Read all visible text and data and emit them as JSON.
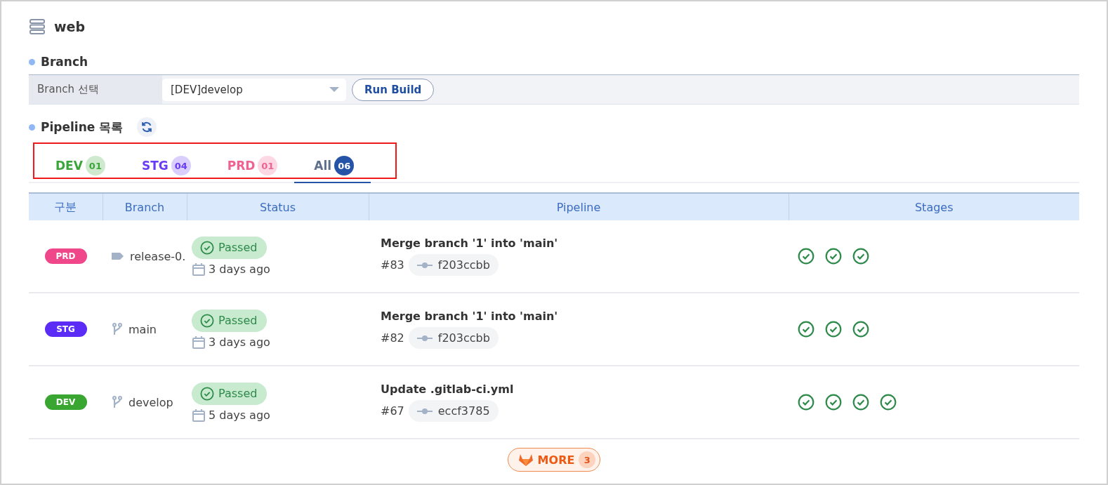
{
  "title": "web",
  "branch_section": {
    "heading": "Branch",
    "label": "Branch 선택",
    "select_value": "[DEV]develop",
    "run_button": "Run Build"
  },
  "pipeline_section": {
    "heading": "Pipeline 목록"
  },
  "tabs": [
    {
      "label": "DEV",
      "count": "01",
      "color": "#3aa63a",
      "selected": false
    },
    {
      "label": "STG",
      "count": "04",
      "color": "#6a3cf5",
      "selected": false
    },
    {
      "label": "PRD",
      "count": "01",
      "color": "#f06292",
      "selected": false
    },
    {
      "label": "All",
      "count": "06",
      "color": "#60708c",
      "selected": true
    }
  ],
  "table": {
    "columns": [
      "구분",
      "Branch",
      "Status",
      "Pipeline",
      "Stages"
    ],
    "rows": [
      {
        "env": "PRD",
        "color": "#f0468a",
        "kind": "tag",
        "branch": "release-0.",
        "status": "Passed",
        "time": "3 days ago",
        "title": "Merge branch '1' into 'main'",
        "number": "#83",
        "commit": "f203ccbb",
        "stages": [
          {
            "kind": "passed"
          },
          {
            "kind": "passed"
          },
          {
            "kind": "passed"
          }
        ]
      },
      {
        "env": "STG",
        "color": "#5b2cf5",
        "kind": "branch",
        "branch": "main",
        "status": "Passed",
        "time": "3 days ago",
        "title": "Merge branch '1' into 'main'",
        "number": "#82",
        "commit": "f203ccbb",
        "stages": [
          {
            "kind": "passed"
          },
          {
            "kind": "passed"
          },
          {
            "kind": "passed"
          }
        ]
      },
      {
        "env": "DEV",
        "color": "#3aa632",
        "kind": "branch",
        "branch": "develop",
        "status": "Passed",
        "time": "5 days ago",
        "title": "Update .gitlab-ci.yml",
        "number": "#67",
        "commit": "eccf3785",
        "stages": [
          {
            "kind": "passed"
          },
          {
            "kind": "passed"
          },
          {
            "kind": "passed"
          },
          {
            "kind": "passed"
          }
        ]
      }
    ]
  },
  "more_button": {
    "label": "MORE",
    "count": "3"
  }
}
